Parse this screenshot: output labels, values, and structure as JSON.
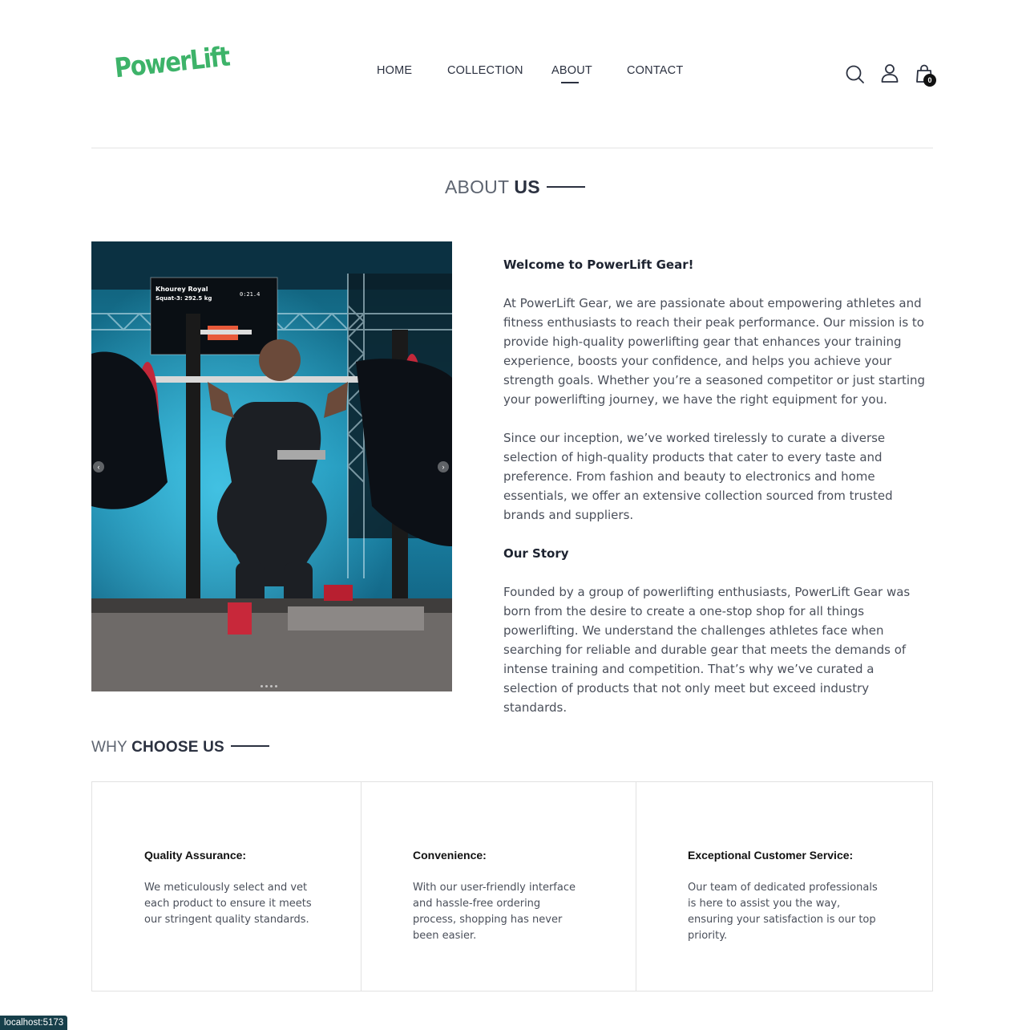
{
  "header": {
    "logo": "PowerLift",
    "nav": [
      {
        "label": "HOME"
      },
      {
        "label": "COLLECTION"
      },
      {
        "label": "ABOUT",
        "active": true
      },
      {
        "label": "CONTACT"
      }
    ],
    "icons": [
      "search-icon",
      "user-icon",
      "shopping-bag-icon"
    ],
    "cart_count": "0"
  },
  "about": {
    "title_light": "ABOUT",
    "title_bold": "US",
    "image_alt": "Powerlifter performing a squat at a competition",
    "welcome_heading": "Welcome to PowerLift Gear!",
    "para1": "At PowerLift Gear, we are passionate about empowering athletes and fitness enthusiasts to reach their peak performance. Our mission is to provide high-quality powerlifting gear that enhances your training experience, boosts your confidence, and helps you achieve your strength goals. Whether you’re a seasoned competitor or just starting your powerlifting journey, we have the right equipment for you.",
    "para2": "Since our inception, we’ve worked tirelessly to curate a diverse selection of high-quality products that cater to every taste and preference. From fashion and beauty to electronics and home essentials, we offer an extensive collection sourced from trusted brands and suppliers.",
    "story_heading": "Our Story",
    "para3": "Founded by a group of powerlifting enthusiasts, PowerLift Gear was born from the desire to create a one-stop shop for all things powerlifting. We understand the challenges athletes face when searching for reliable and durable gear that meets the demands of intense training and competition. That’s why we’ve curated a selection of products that not only meet but exceed industry standards."
  },
  "why": {
    "title_light": "WHY",
    "title_bold": "CHOOSE US",
    "cards": [
      {
        "title": "Quality Assurance:",
        "text": "We meticulously select and vet each product to ensure it meets our stringent quality standards."
      },
      {
        "title": "Convenience:",
        "text": "With our user-friendly interface and hassle-free ordering process, shopping has never been easier."
      },
      {
        "title": "Exceptional Customer Service:",
        "text": "Our team of dedicated professionals is here to assist you the way, ensuring your satisfaction is our top priority."
      }
    ]
  },
  "photo_scoreboard": {
    "name": "Khourey Royal",
    "lift": "Squat-3: 292.5 kg",
    "timer": "0:21.4"
  },
  "status_bar": "localhost:5173",
  "colors": {
    "brand": "#3db369",
    "text_dark": "#2b3140"
  }
}
